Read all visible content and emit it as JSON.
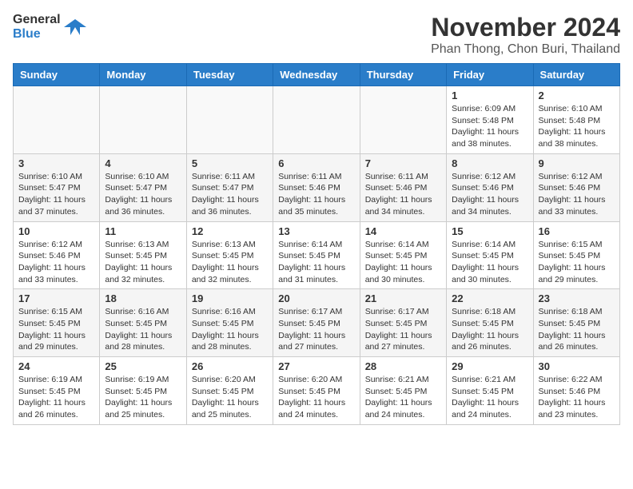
{
  "logo": {
    "text_general": "General",
    "text_blue": "Blue"
  },
  "header": {
    "month": "November 2024",
    "location": "Phan Thong, Chon Buri, Thailand"
  },
  "days_of_week": [
    "Sunday",
    "Monday",
    "Tuesday",
    "Wednesday",
    "Thursday",
    "Friday",
    "Saturday"
  ],
  "weeks": [
    [
      {
        "day": "",
        "info": ""
      },
      {
        "day": "",
        "info": ""
      },
      {
        "day": "",
        "info": ""
      },
      {
        "day": "",
        "info": ""
      },
      {
        "day": "",
        "info": ""
      },
      {
        "day": "1",
        "info": "Sunrise: 6:09 AM\nSunset: 5:48 PM\nDaylight: 11 hours and 38 minutes."
      },
      {
        "day": "2",
        "info": "Sunrise: 6:10 AM\nSunset: 5:48 PM\nDaylight: 11 hours and 38 minutes."
      }
    ],
    [
      {
        "day": "3",
        "info": "Sunrise: 6:10 AM\nSunset: 5:47 PM\nDaylight: 11 hours and 37 minutes."
      },
      {
        "day": "4",
        "info": "Sunrise: 6:10 AM\nSunset: 5:47 PM\nDaylight: 11 hours and 36 minutes."
      },
      {
        "day": "5",
        "info": "Sunrise: 6:11 AM\nSunset: 5:47 PM\nDaylight: 11 hours and 36 minutes."
      },
      {
        "day": "6",
        "info": "Sunrise: 6:11 AM\nSunset: 5:46 PM\nDaylight: 11 hours and 35 minutes."
      },
      {
        "day": "7",
        "info": "Sunrise: 6:11 AM\nSunset: 5:46 PM\nDaylight: 11 hours and 34 minutes."
      },
      {
        "day": "8",
        "info": "Sunrise: 6:12 AM\nSunset: 5:46 PM\nDaylight: 11 hours and 34 minutes."
      },
      {
        "day": "9",
        "info": "Sunrise: 6:12 AM\nSunset: 5:46 PM\nDaylight: 11 hours and 33 minutes."
      }
    ],
    [
      {
        "day": "10",
        "info": "Sunrise: 6:12 AM\nSunset: 5:46 PM\nDaylight: 11 hours and 33 minutes."
      },
      {
        "day": "11",
        "info": "Sunrise: 6:13 AM\nSunset: 5:45 PM\nDaylight: 11 hours and 32 minutes."
      },
      {
        "day": "12",
        "info": "Sunrise: 6:13 AM\nSunset: 5:45 PM\nDaylight: 11 hours and 32 minutes."
      },
      {
        "day": "13",
        "info": "Sunrise: 6:14 AM\nSunset: 5:45 PM\nDaylight: 11 hours and 31 minutes."
      },
      {
        "day": "14",
        "info": "Sunrise: 6:14 AM\nSunset: 5:45 PM\nDaylight: 11 hours and 30 minutes."
      },
      {
        "day": "15",
        "info": "Sunrise: 6:14 AM\nSunset: 5:45 PM\nDaylight: 11 hours and 30 minutes."
      },
      {
        "day": "16",
        "info": "Sunrise: 6:15 AM\nSunset: 5:45 PM\nDaylight: 11 hours and 29 minutes."
      }
    ],
    [
      {
        "day": "17",
        "info": "Sunrise: 6:15 AM\nSunset: 5:45 PM\nDaylight: 11 hours and 29 minutes."
      },
      {
        "day": "18",
        "info": "Sunrise: 6:16 AM\nSunset: 5:45 PM\nDaylight: 11 hours and 28 minutes."
      },
      {
        "day": "19",
        "info": "Sunrise: 6:16 AM\nSunset: 5:45 PM\nDaylight: 11 hours and 28 minutes."
      },
      {
        "day": "20",
        "info": "Sunrise: 6:17 AM\nSunset: 5:45 PM\nDaylight: 11 hours and 27 minutes."
      },
      {
        "day": "21",
        "info": "Sunrise: 6:17 AM\nSunset: 5:45 PM\nDaylight: 11 hours and 27 minutes."
      },
      {
        "day": "22",
        "info": "Sunrise: 6:18 AM\nSunset: 5:45 PM\nDaylight: 11 hours and 26 minutes."
      },
      {
        "day": "23",
        "info": "Sunrise: 6:18 AM\nSunset: 5:45 PM\nDaylight: 11 hours and 26 minutes."
      }
    ],
    [
      {
        "day": "24",
        "info": "Sunrise: 6:19 AM\nSunset: 5:45 PM\nDaylight: 11 hours and 26 minutes."
      },
      {
        "day": "25",
        "info": "Sunrise: 6:19 AM\nSunset: 5:45 PM\nDaylight: 11 hours and 25 minutes."
      },
      {
        "day": "26",
        "info": "Sunrise: 6:20 AM\nSunset: 5:45 PM\nDaylight: 11 hours and 25 minutes."
      },
      {
        "day": "27",
        "info": "Sunrise: 6:20 AM\nSunset: 5:45 PM\nDaylight: 11 hours and 24 minutes."
      },
      {
        "day": "28",
        "info": "Sunrise: 6:21 AM\nSunset: 5:45 PM\nDaylight: 11 hours and 24 minutes."
      },
      {
        "day": "29",
        "info": "Sunrise: 6:21 AM\nSunset: 5:45 PM\nDaylight: 11 hours and 24 minutes."
      },
      {
        "day": "30",
        "info": "Sunrise: 6:22 AM\nSunset: 5:46 PM\nDaylight: 11 hours and 23 minutes."
      }
    ]
  ]
}
